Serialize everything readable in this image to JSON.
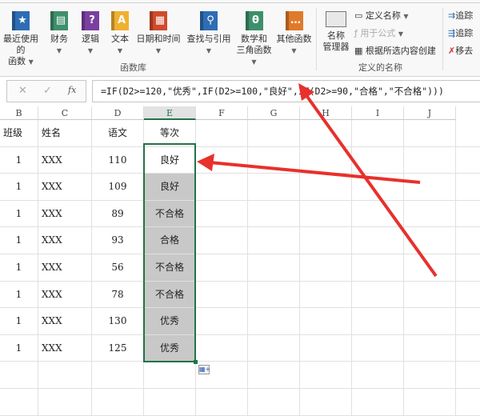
{
  "ribbon": {
    "function_library": [
      {
        "label1": "最近使用的",
        "label2": "函数",
        "icon": "star-icon",
        "color": "#2e6db4"
      },
      {
        "label1": "财务",
        "label2": "",
        "icon": "finance-book-icon",
        "color": "#3f8f6b"
      },
      {
        "label1": "逻辑",
        "label2": "",
        "icon": "question-book-icon",
        "color": "#7b3fa0"
      },
      {
        "label1": "文本",
        "label2": "",
        "icon": "text-book-icon",
        "color": "#f0b030"
      },
      {
        "label1": "日期和时间",
        "label2": "",
        "icon": "calendar-book-icon",
        "color": "#d04a2a"
      },
      {
        "label1": "查找与引用",
        "label2": "",
        "icon": "search-book-icon",
        "color": "#2e6db4"
      },
      {
        "label1": "数学和",
        "label2": "三角函数",
        "icon": "theta-book-icon",
        "color": "#3f8f6b"
      },
      {
        "label1": "其他函数",
        "label2": "",
        "icon": "more-book-icon",
        "color": "#e07a2a"
      }
    ],
    "icon_glyphs": [
      "★",
      "▤",
      "?",
      "A",
      "▦",
      "⚲",
      "θ",
      "…"
    ],
    "function_library_label": "函数库",
    "name_manager": {
      "label1": "名称",
      "label2": "管理器"
    },
    "define_name": "定义名称",
    "use_in_formula": "用于公式",
    "create_from_selection": "根据所选内容创建",
    "defined_names_label": "定义的名称",
    "trace_precedents": "追踪",
    "trace_dependents": "追踪",
    "remove_arrows": "移去"
  },
  "formula_bar": {
    "cancel": "✕",
    "enter": "✓",
    "fx": "fx",
    "formula": "=IF(D2>=120,\"优秀\",IF(D2>=100,\"良好\",IF(D2>=90,\"合格\",\"不合格\")))"
  },
  "columns": [
    "B",
    "C",
    "D",
    "E",
    "F",
    "G",
    "H",
    "I",
    "J"
  ],
  "headers": [
    "班级",
    "姓名",
    "语文",
    "等次"
  ],
  "rows": [
    [
      "1",
      "XXX",
      "110",
      "良好"
    ],
    [
      "1",
      "XXX",
      "109",
      "良好"
    ],
    [
      "1",
      "XXX",
      "89",
      "不合格"
    ],
    [
      "1",
      "XXX",
      "93",
      "合格"
    ],
    [
      "1",
      "XXX",
      "56",
      "不合格"
    ],
    [
      "1",
      "XXX",
      "78",
      "不合格"
    ],
    [
      "1",
      "XXX",
      "130",
      "优秀"
    ],
    [
      "1",
      "XXX",
      "125",
      "优秀"
    ]
  ],
  "colors": {
    "accent": "#217346",
    "arrow": "#e8302c",
    "selection": "#c8c8c8"
  }
}
